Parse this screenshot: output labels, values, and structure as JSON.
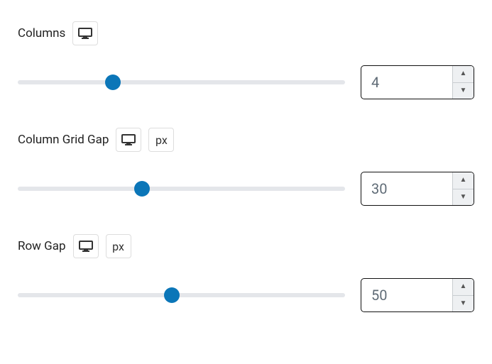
{
  "controls": {
    "columns": {
      "label": "Columns",
      "value": "4",
      "sliderPercent": 29
    },
    "columnGridGap": {
      "label": "Column Grid Gap",
      "unit": "px",
      "value": "30",
      "sliderPercent": 38
    },
    "rowGap": {
      "label": "Row Gap",
      "unit": "px",
      "value": "50",
      "sliderPercent": 47
    }
  }
}
